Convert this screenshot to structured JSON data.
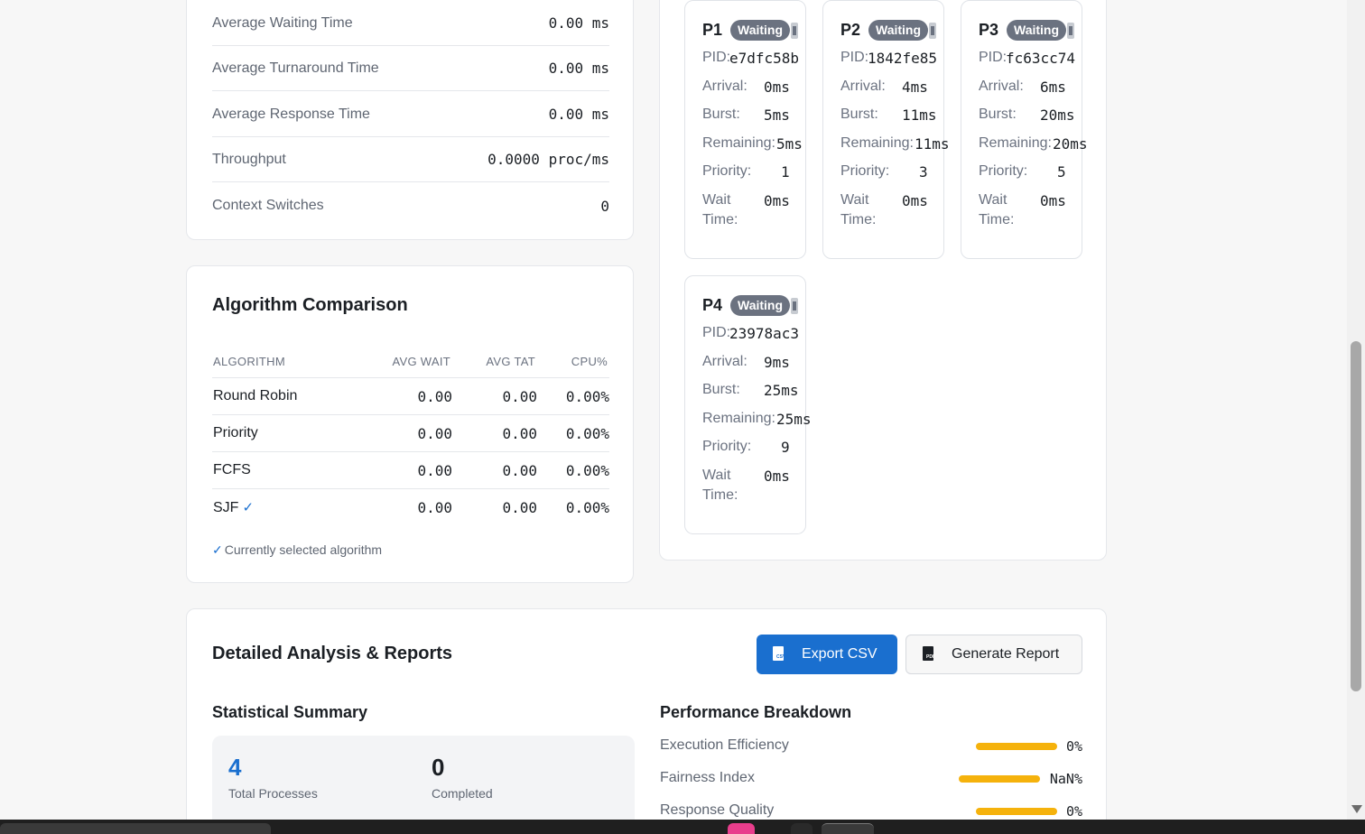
{
  "metrics": {
    "rows": [
      {
        "label": "Average Waiting Time",
        "value": "0.00 ms"
      },
      {
        "label": "Average Turnaround Time",
        "value": "0.00 ms"
      },
      {
        "label": "Average Response Time",
        "value": "0.00 ms"
      },
      {
        "label": "Throughput",
        "value": "0.0000 proc/ms"
      },
      {
        "label": "Context Switches",
        "value": "0"
      }
    ]
  },
  "algorithm_comparison": {
    "title": "Algorithm Comparison",
    "headers": [
      "ALGORITHM",
      "AVG WAIT",
      "AVG TAT",
      "CPU%"
    ],
    "rows": [
      {
        "name": "Round Robin",
        "avg_wait": "0.00",
        "avg_tat": "0.00",
        "cpu": "0.00%",
        "selected": false
      },
      {
        "name": "Priority",
        "avg_wait": "0.00",
        "avg_tat": "0.00",
        "cpu": "0.00%",
        "selected": false
      },
      {
        "name": "FCFS",
        "avg_wait": "0.00",
        "avg_tat": "0.00",
        "cpu": "0.00%",
        "selected": false
      },
      {
        "name": "SJF",
        "avg_wait": "0.00",
        "avg_tat": "0.00",
        "cpu": "0.00%",
        "selected": true
      }
    ],
    "check_glyph": "✓",
    "note": "Currently selected algorithm"
  },
  "process_labels": {
    "pid": "PID:",
    "arrival": "Arrival:",
    "burst": "Burst:",
    "remaining": "Remaining:",
    "priority": "Priority:",
    "wait_line1": "Wait",
    "wait_line2": "Time:"
  },
  "processes": [
    {
      "name": "P1",
      "status": "Waiting",
      "pid": "e7dfc58b",
      "arrival": "0ms",
      "burst": "5ms",
      "remaining": "5ms",
      "priority": "1",
      "wait": "0ms"
    },
    {
      "name": "P2",
      "status": "Waiting",
      "pid": "1842fe85",
      "arrival": "4ms",
      "burst": "11ms",
      "remaining": "11ms",
      "priority": "3",
      "wait": "0ms"
    },
    {
      "name": "P3",
      "status": "Waiting",
      "pid": "fc63cc74",
      "arrival": "6ms",
      "burst": "20ms",
      "remaining": "20ms",
      "priority": "5",
      "wait": "0ms"
    },
    {
      "name": "P4",
      "status": "Waiting",
      "pid": "23978ac3",
      "arrival": "9ms",
      "burst": "25ms",
      "remaining": "25ms",
      "priority": "9",
      "wait": "0ms"
    }
  ],
  "reports": {
    "title": "Detailed Analysis & Reports",
    "export_label": "Export CSV",
    "export_icon_tag": "CSV",
    "report_label": "Generate Report",
    "report_icon_tag": "PDF",
    "statistical_summary": {
      "title": "Statistical Summary",
      "items": [
        {
          "value": "4",
          "label": "Total Processes",
          "color": "#1a6fcf"
        },
        {
          "value": "0",
          "label": "Completed",
          "color": "#1b1f24"
        }
      ]
    },
    "performance_breakdown": {
      "title": "Performance Breakdown",
      "bar_color": "#f5b20c",
      "rows": [
        {
          "label": "Execution Efficiency",
          "value": "0%"
        },
        {
          "label": "Fairness Index",
          "value": "NaN%"
        },
        {
          "label": "Response Quality",
          "value": "0%"
        }
      ]
    }
  },
  "colors": {
    "accent": "#1a6fcf",
    "badge": "#6b7280",
    "bar": "#f5b20c"
  }
}
